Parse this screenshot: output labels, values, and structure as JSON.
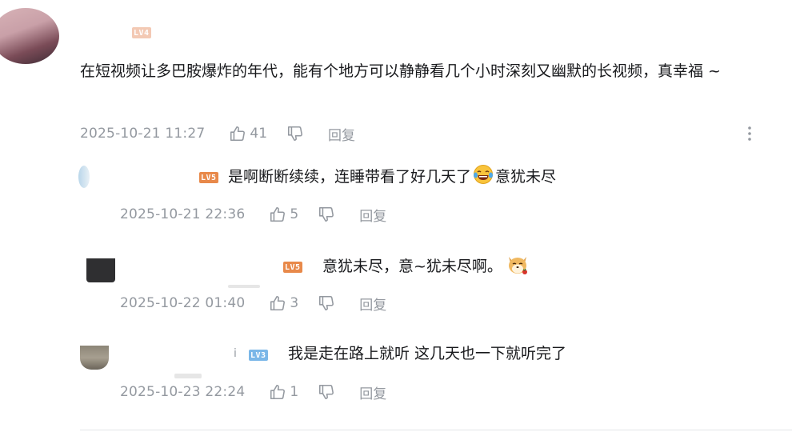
{
  "colors": {
    "text": "#18191c",
    "meta": "#9499a0",
    "lv4": "#f3c9b4",
    "lv5": "#e8894a",
    "lv3": "#7bb7e8"
  },
  "main_comment": {
    "level": "LV4",
    "text": "在短视频让多巴胺爆炸的年代，能有个地方可以静静看几个小时深刻又幽默的长视频，真幸福 ~",
    "time": "2025-10-21 11:27",
    "likes": "41",
    "reply_label": "回复",
    "more_icon": "more-vertical-icon"
  },
  "replies": [
    {
      "level": "LV5",
      "text_before_emoji": "是啊断断续续，连睡带看了好几天了",
      "emoji": "laughing-tears-emoji",
      "text_after_emoji": "意犹未尽",
      "time": "2025-10-21 22:36",
      "likes": "5",
      "reply_label": "回复"
    },
    {
      "level": "LV5",
      "text": "意犹未尽，意~犹未尽啊。",
      "emoji": "shiba-dog-emoji",
      "time": "2025-10-22 01:40",
      "likes": "3",
      "reply_label": "回复"
    },
    {
      "name_fragment": "i",
      "level": "LV3",
      "text": "我是走在路上就听 这几天也一下就听完了",
      "time": "2025-10-23 22:24",
      "likes": "1",
      "reply_label": "回复"
    }
  ]
}
